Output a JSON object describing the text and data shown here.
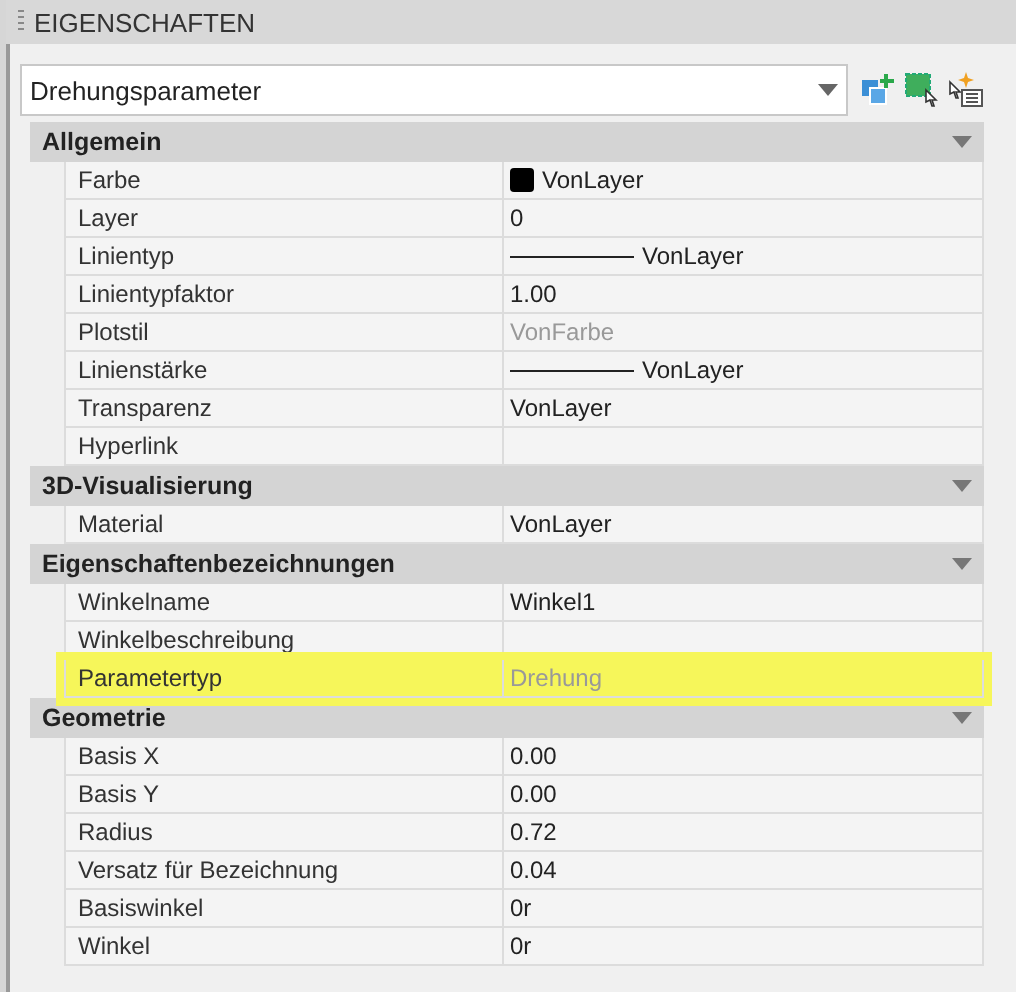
{
  "panel": {
    "title": "EIGENSCHAFTEN"
  },
  "selector": {
    "value": "Drehungsparameter"
  },
  "toolbar": [
    {
      "kind": "add"
    },
    {
      "kind": "select"
    },
    {
      "kind": "quick"
    }
  ],
  "sections": [
    {
      "title": "Allgemein",
      "expanded": true,
      "rows": [
        {
          "label": "Farbe",
          "value": "VonLayer",
          "kind": "color",
          "disabled": false,
          "highlighted": false
        },
        {
          "label": "Layer",
          "value": "0",
          "kind": "text",
          "disabled": false,
          "highlighted": false
        },
        {
          "label": "Linientyp",
          "value": "VonLayer",
          "kind": "linetype",
          "disabled": false,
          "highlighted": false
        },
        {
          "label": "Linientypfaktor",
          "value": "1.00",
          "kind": "text",
          "disabled": false,
          "highlighted": false
        },
        {
          "label": "Plotstil",
          "value": "VonFarbe",
          "kind": "text",
          "disabled": true,
          "highlighted": false
        },
        {
          "label": "Linienstärke",
          "value": "VonLayer",
          "kind": "linetype",
          "disabled": false,
          "highlighted": false
        },
        {
          "label": "Transparenz",
          "value": "VonLayer",
          "kind": "text",
          "disabled": false,
          "highlighted": false
        },
        {
          "label": "Hyperlink",
          "kind": "text",
          "highlighted": false
        }
      ]
    },
    {
      "title": "3D-Visualisierung",
      "expanded": true,
      "rows": [
        {
          "label": "Material",
          "value": "VonLayer",
          "kind": "text",
          "disabled": false,
          "highlighted": false
        }
      ]
    },
    {
      "title": "Eigenschaftenbezeichnungen",
      "expanded": true,
      "rows": [
        {
          "label": "Winkelname",
          "value": "Winkel1",
          "kind": "text",
          "disabled": false,
          "highlighted": false
        },
        {
          "label": "Winkelbeschreibung",
          "kind": "text",
          "highlighted": false
        },
        {
          "label": "Parametertyp",
          "value": "Drehung",
          "kind": "text",
          "disabled": true,
          "highlighted": true
        }
      ]
    },
    {
      "title": "Geometrie",
      "expanded": true,
      "rows": [
        {
          "label": "Basis X",
          "value": "0.00",
          "kind": "text",
          "disabled": false,
          "highlighted": false
        },
        {
          "label": "Basis Y",
          "value": "0.00",
          "kind": "text",
          "disabled": false,
          "highlighted": false
        },
        {
          "label": "Radius",
          "value": "0.72",
          "kind": "text",
          "disabled": false,
          "highlighted": false
        },
        {
          "label": "Versatz für Bezeichnung",
          "value": "0.04",
          "kind": "text",
          "disabled": false,
          "highlighted": false
        },
        {
          "label": "Basiswinkel",
          "value": "0r",
          "kind": "text",
          "disabled": false,
          "highlighted": false
        },
        {
          "label": "Winkel",
          "value": "0r",
          "kind": "text",
          "disabled": false,
          "highlighted": false
        }
      ]
    }
  ]
}
